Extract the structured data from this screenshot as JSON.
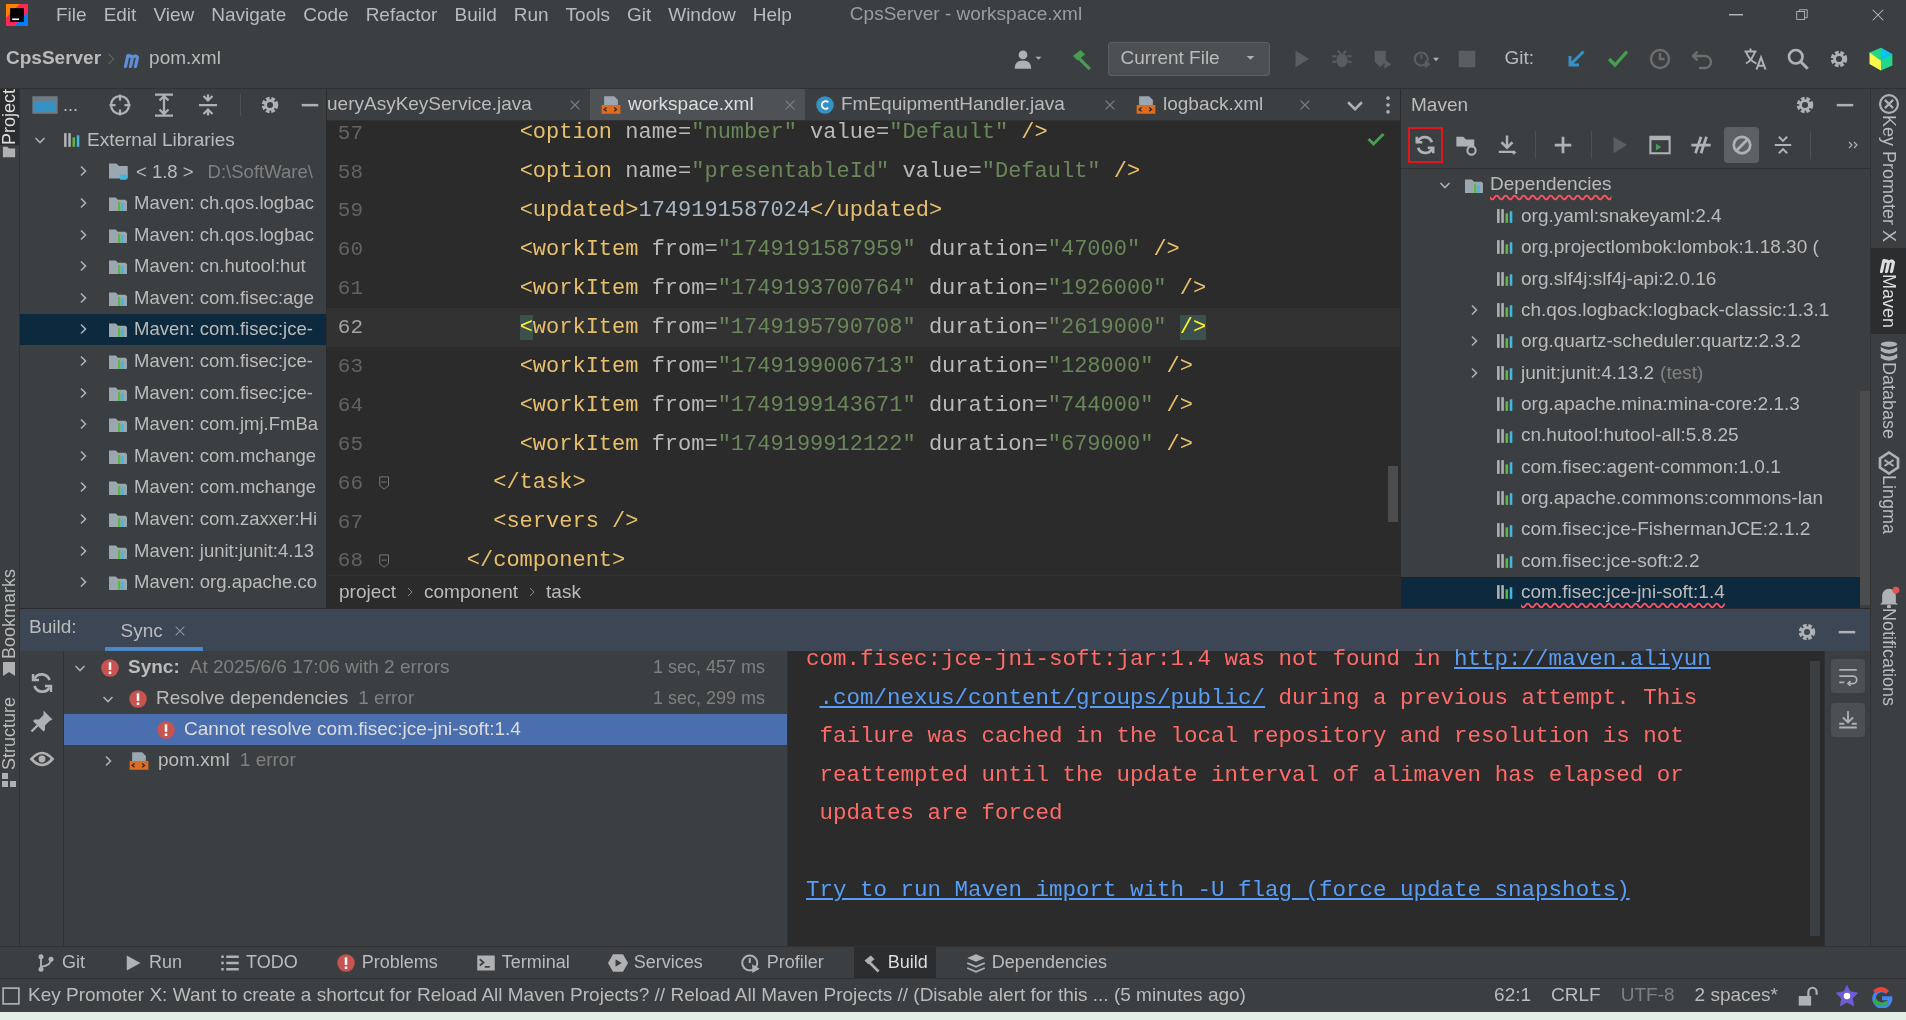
{
  "menu": {
    "items": [
      "File",
      "Edit",
      "View",
      "Navigate",
      "Code",
      "Refactor",
      "Build",
      "Run",
      "Tools",
      "Git",
      "Window",
      "Help"
    ],
    "title": "CpsServer - workspace.xml"
  },
  "nav": {
    "project": "CpsServer",
    "file": "pom.xml",
    "run_config": "Current File",
    "vcs_label": "Git:",
    "toolbar": [
      {
        "kind": "run",
        "disabled": true
      },
      {
        "kind": "debug",
        "disabled": true
      },
      {
        "kind": "coverage",
        "disabled": true
      },
      {
        "kind": "profile",
        "disabled": true
      },
      {
        "kind": "stop",
        "disabled": true
      }
    ]
  },
  "left_stripe": [
    {
      "label": "Project",
      "selected": true
    },
    {
      "label": "Bookmarks",
      "selected": false
    },
    {
      "label": "Structure",
      "selected": false
    }
  ],
  "right_stripe": [
    {
      "label": "Key Promoter X",
      "selected": false
    },
    {
      "label": "Maven",
      "selected": true
    },
    {
      "label": "Database",
      "selected": false
    },
    {
      "label": "Lingma",
      "selected": false
    },
    {
      "label": "Notifications",
      "selected": false
    }
  ],
  "project_panel": {
    "title": "...",
    "tree": [
      {
        "label": "External Libraries",
        "kind": "libraries",
        "expanded": true,
        "selected": false,
        "children": [
          {
            "label": "< 1.8 >",
            "hint": "D:\\SoftWare\\",
            "kind": "jdk",
            "expanded": false,
            "selected": false
          },
          {
            "label": "Maven: ch.qos.logbac",
            "kind": "library",
            "expanded": false,
            "selected": false
          },
          {
            "label": "Maven: ch.qos.logbac",
            "kind": "library",
            "expanded": false,
            "selected": false
          },
          {
            "label": "Maven: cn.hutool:hut",
            "kind": "library",
            "expanded": false,
            "selected": false
          },
          {
            "label": "Maven: com.fisec:age",
            "kind": "library",
            "expanded": false,
            "selected": false
          },
          {
            "label": "Maven: com.fisec:jce-",
            "kind": "library",
            "expanded": false,
            "selected": true
          },
          {
            "label": "Maven: com.fisec:jce-",
            "kind": "library",
            "expanded": false,
            "selected": false
          },
          {
            "label": "Maven: com.fisec:jce-",
            "kind": "library",
            "expanded": false,
            "selected": false
          },
          {
            "label": "Maven: com.jmj.FmBa",
            "kind": "library",
            "expanded": false,
            "selected": false
          },
          {
            "label": "Maven: com.mchange",
            "kind": "library",
            "expanded": false,
            "selected": false
          },
          {
            "label": "Maven: com.mchange",
            "kind": "library",
            "expanded": false,
            "selected": false
          },
          {
            "label": "Maven: com.zaxxer:Hi",
            "kind": "library",
            "expanded": false,
            "selected": false
          },
          {
            "label": "Maven: junit:junit:4.13",
            "kind": "library",
            "expanded": false,
            "selected": false
          },
          {
            "label": "Maven: org.apache.co",
            "kind": "library",
            "expanded": false,
            "selected": false
          }
        ]
      }
    ]
  },
  "editor": {
    "tabs": [
      {
        "label": "ueryAsyKeyService.java",
        "kind": "cut",
        "selected": false
      },
      {
        "label": "workspace.xml",
        "kind": "xml",
        "selected": true
      },
      {
        "label": "FmEquipmentHandler.java",
        "kind": "class",
        "selected": false
      },
      {
        "label": "logback.xml",
        "kind": "xml",
        "selected": false
      }
    ],
    "lines": [
      {
        "number": "57",
        "code": "        <option name=\"number\" value=\"Default\" />",
        "current": false,
        "folding": false
      },
      {
        "number": "58",
        "code": "        <option name=\"presentableId\" value=\"Default\" />",
        "current": false,
        "folding": false
      },
      {
        "number": "59",
        "code": "        <updated>1749191587024</updated>",
        "current": false,
        "folding": false
      },
      {
        "number": "60",
        "code": "        <workItem from=\"1749191587959\" duration=\"47000\" />",
        "current": false,
        "folding": false
      },
      {
        "number": "61",
        "code": "        <workItem from=\"1749193700764\" duration=\"1926000\" />",
        "current": false,
        "folding": false
      },
      {
        "number": "62",
        "code": "        <workItem from=\"1749195790708\" duration=\"2619000\" />",
        "current": true,
        "folding": false
      },
      {
        "number": "63",
        "code": "        <workItem from=\"1749199006713\" duration=\"128000\" />",
        "current": false,
        "folding": false
      },
      {
        "number": "64",
        "code": "        <workItem from=\"1749199143671\" duration=\"744000\" />",
        "current": false,
        "folding": false
      },
      {
        "number": "65",
        "code": "        <workItem from=\"1749199912122\" duration=\"679000\" />",
        "current": false,
        "folding": false
      },
      {
        "number": "66",
        "code": "      </task>",
        "current": false,
        "folding": true
      },
      {
        "number": "67",
        "code": "      <servers />",
        "current": false,
        "folding": false
      },
      {
        "number": "68",
        "code": "    </component>",
        "current": false,
        "folding": true
      }
    ],
    "breadcrumbs": [
      "project",
      "component",
      "task"
    ]
  },
  "maven_panel": {
    "title": "Maven",
    "toolbar": [
      {
        "kind": "reload",
        "outlined": true,
        "selected": false,
        "disabled": false
      },
      {
        "kind": "reimport",
        "outlined": false,
        "selected": false,
        "disabled": false
      },
      {
        "kind": "download",
        "outlined": false,
        "selected": false,
        "disabled": false
      },
      {
        "kind": "add",
        "outlined": false,
        "selected": false,
        "disabled": false
      },
      {
        "kind": "run",
        "outlined": false,
        "selected": false,
        "disabled": true
      },
      {
        "kind": "execute",
        "outlined": false,
        "selected": false,
        "disabled": false
      },
      {
        "kind": "offline",
        "outlined": false,
        "selected": false,
        "disabled": false
      },
      {
        "kind": "skip-tests",
        "outlined": false,
        "selected": true,
        "disabled": false
      },
      {
        "kind": "collapse",
        "outlined": false,
        "selected": false,
        "disabled": false
      },
      {
        "kind": "more",
        "outlined": false,
        "selected": false,
        "disabled": false
      }
    ],
    "tree": [
      {
        "label": "Dependencies",
        "kind": "folder",
        "expanded": true,
        "selected": false,
        "error": true,
        "children": [
          {
            "label": "org.yaml:snakeyaml:2.4",
            "kind": "leaf",
            "selected": false,
            "error": false
          },
          {
            "label": "org.projectlombok:lombok:1.18.30 (",
            "kind": "leaf",
            "selected": false,
            "error": false
          },
          {
            "label": "org.slf4j:slf4j-api:2.0.16",
            "kind": "leaf",
            "selected": false,
            "error": false
          },
          {
            "label": "ch.qos.logback:logback-classic:1.3.1",
            "kind": "group",
            "selected": false,
            "error": false
          },
          {
            "label": "org.quartz-scheduler:quartz:2.3.2",
            "kind": "group",
            "selected": false,
            "error": false
          },
          {
            "label": "junit:junit:4.13.2",
            "scope": "(test)",
            "kind": "group",
            "selected": false,
            "error": false
          },
          {
            "label": "org.apache.mina:mina-core:2.1.3",
            "kind": "leaf",
            "selected": false,
            "error": false
          },
          {
            "label": "cn.hutool:hutool-all:5.8.25",
            "kind": "leaf",
            "selected": false,
            "error": false
          },
          {
            "label": "com.fisec:agent-common:1.0.1",
            "kind": "leaf",
            "selected": false,
            "error": false
          },
          {
            "label": "org.apache.commons:commons-lan",
            "kind": "leaf",
            "selected": false,
            "error": false
          },
          {
            "label": "com.fisec:jce-FishermanJCE:2.1.2",
            "kind": "leaf",
            "selected": false,
            "error": false
          },
          {
            "label": "com.fisec:jce-soft:2.2",
            "kind": "leaf",
            "selected": false,
            "error": false
          },
          {
            "label": "com.fisec:jce-jni-soft:1.4",
            "kind": "leaf",
            "selected": true,
            "error": true
          }
        ]
      }
    ]
  },
  "build": {
    "label": "Build:",
    "tabs": [
      {
        "label": "Sync",
        "selected": true
      }
    ],
    "tree": [
      {
        "kind": "error",
        "label": "Sync:",
        "detail": "At 2025/6/6 17:06 with 2 errors",
        "time": "1 sec, 457 ms",
        "expanded": true,
        "selected": false,
        "children": [
          {
            "kind": "error",
            "label": "Resolve dependencies",
            "detail": "1 error",
            "time": "1 sec, 299 ms",
            "expanded": true,
            "selected": false,
            "children": [
              {
                "kind": "error",
                "label": "Cannot resolve com.fisec:jce-jni-soft:1.4",
                "selected": true
              }
            ]
          },
          {
            "kind": "file",
            "label": "pom.xml",
            "detail": "1 error",
            "expanded": false,
            "selected": false
          }
        ]
      }
    ],
    "console": {
      "segments": [
        {
          "kind": "text",
          "text": "com.fisec:jce-jni-soft:jar:1.4 was not found in "
        },
        {
          "kind": "link",
          "text": "http://maven.aliyun",
          "break_after": true
        },
        {
          "kind": "link",
          "text": ".com/nexus/content/groups/public/",
          "break_after": false
        },
        {
          "kind": "text",
          "text": " during a previous attempt. This\n failure was cached in the local repository and resolution is not\n reattempted until the update interval of alimaven has elapsed or\n updates are forced"
        }
      ],
      "action_link": "Try to run Maven import with -U flag (force update snapshots)"
    }
  },
  "bottom_tabs": [
    {
      "label": "Git",
      "kind": "git",
      "selected": false
    },
    {
      "label": "Run",
      "kind": "run",
      "selected": false
    },
    {
      "label": "TODO",
      "kind": "todo",
      "selected": false
    },
    {
      "label": "Problems",
      "kind": "problems",
      "selected": false
    },
    {
      "label": "Terminal",
      "kind": "terminal",
      "selected": false
    },
    {
      "label": "Services",
      "kind": "services",
      "selected": false
    },
    {
      "label": "Profiler",
      "kind": "profiler",
      "selected": false
    },
    {
      "label": "Build",
      "kind": "build",
      "selected": true
    },
    {
      "label": "Dependencies",
      "kind": "dependencies",
      "selected": false
    }
  ],
  "status_bar": {
    "message": "Key Promoter X: Want to create a shortcut for Reload All Maven Projects? // Reload All Maven Projects // (Disable alert for this ... (5 minutes ago)",
    "items": [
      {
        "text": "62:1",
        "dim": false
      },
      {
        "text": "CRLF",
        "dim": false
      },
      {
        "text": "UTF-8",
        "dim": true
      },
      {
        "text": "2 spaces*",
        "dim": false
      }
    ]
  }
}
